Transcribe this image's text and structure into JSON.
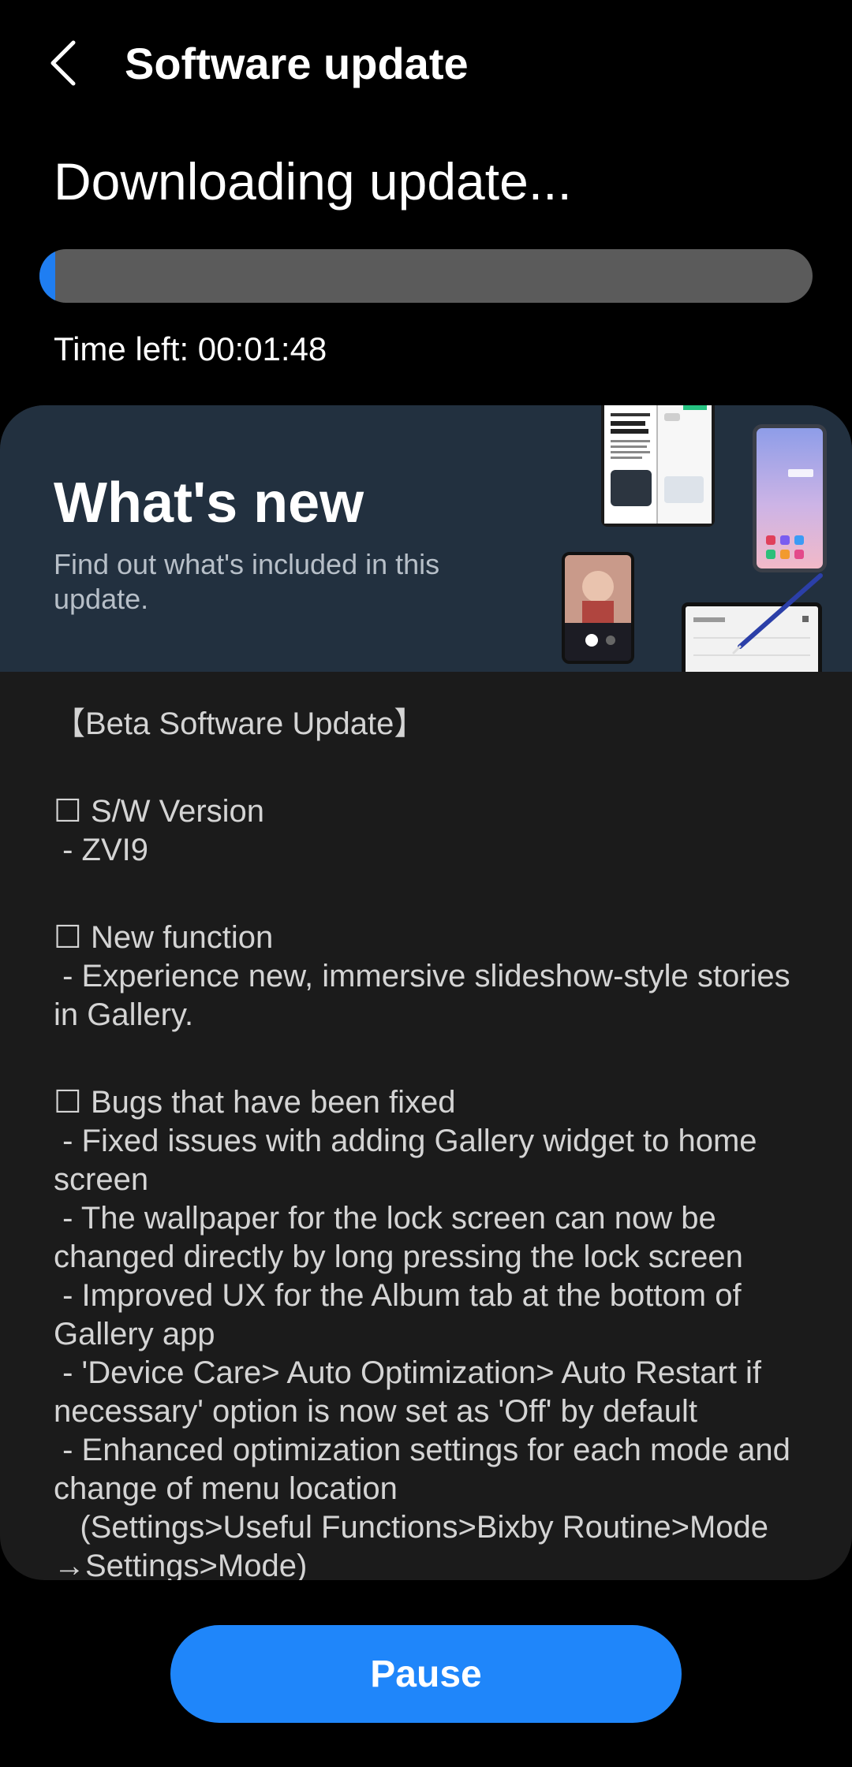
{
  "header": {
    "back_icon": "chevron-left-icon",
    "title": "Software update"
  },
  "status": {
    "heading": "Downloading update...",
    "progress_fraction": 0.02,
    "progress_color": "#1f7ef2",
    "time_left": "Time left: 00:01:48"
  },
  "whats_new": {
    "title": "What's new",
    "subtitle": "Find out what's included in this update.",
    "notes": [
      "【Beta Software Update】",
      "☐ S/W Version\n - ZVI9",
      "☐ New function\n - Experience new, immersive slideshow-style stories in Gallery.",
      "☐ Bugs that have been fixed\n - Fixed issues with adding Gallery widget to home screen\n - The wallpaper for the lock screen can now be changed directly by long pressing the lock screen\n - Improved UX for the Album tab at the bottom of Gallery app\n - 'Device Care> Auto Optimization> Auto Restart if necessary' option is now set as 'Off' by default\n - Enhanced optimization settings for each mode and change of menu location\n   (Settings>Useful Functions>Bixby Routine>Mode\n→Settings>Mode)"
    ]
  },
  "actions": {
    "pause_label": "Pause",
    "accent_color": "#1f86fa"
  }
}
